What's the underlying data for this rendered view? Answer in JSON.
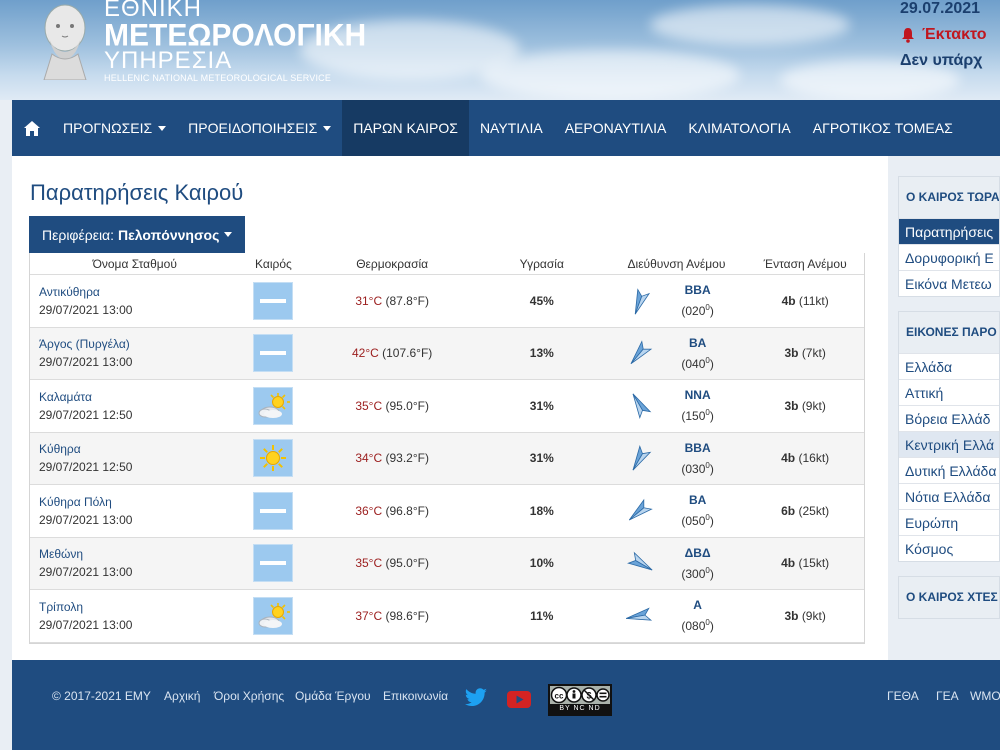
{
  "header": {
    "logo_line1": "ΕΘΝΙΚΗ",
    "logo_line2": "ΜΕΤΕΩΡΟΛΟΓΙΚΗ",
    "logo_line3": "ΥΠΗΡΕΣΙΑ",
    "logo_line4": "HELLENIC NATIONAL METEOROLOGICAL SERVICE",
    "date": "29.07.2021",
    "alert_label": "Έκτακτο",
    "no_alert_text": "Δεν υπάρχ"
  },
  "nav": {
    "home_icon": "home-icon",
    "items": [
      {
        "label": "ΠΡΟΓΝΩΣΕΙΣ",
        "dropdown": true
      },
      {
        "label": "ΠΡΟΕΙΔΟΠΟΙΗΣΕΙΣ",
        "dropdown": true
      },
      {
        "label": "ΠΑΡΩΝ ΚΑΙΡΟΣ",
        "active": true
      },
      {
        "label": "ΝΑΥΤΙΛΙΑ"
      },
      {
        "label": "ΑΕΡΟΝΑΥΤΙΛΙΑ"
      },
      {
        "label": "ΚΛΙΜΑΤΟΛΟΓΙΑ"
      },
      {
        "label": "ΑΓΡΟΤΙΚΟΣ ΤΟΜΕΑΣ"
      }
    ]
  },
  "main": {
    "title": "Παρατηρήσεις Καιρού",
    "region_label": "Περιφέρεια:",
    "region_value": "Πελοπόννησος",
    "columns": [
      "Όνομα Σταθμού",
      "Καιρός",
      "Θερμοκρασία",
      "Υγρασία",
      "Διεύθυνση Ανέμου",
      "Ένταση Ανέμου"
    ],
    "rows": [
      {
        "name": "Αντικύθηρα",
        "time": "29/07/2021 13:00",
        "weather": "haze",
        "temp_c": "31°C",
        "temp_f": "(87.8°F)",
        "humidity": "45%",
        "wind_dir": "ΒΒΑ",
        "wind_deg": "(020",
        "wind_deg_sup": "0",
        "wind_deg_close": ")",
        "wind_angle": 20,
        "wind_bf": "4b",
        "wind_kt": "(11kt)"
      },
      {
        "name": "Άργος (Πυργέλα)",
        "time": "29/07/2021 13:00",
        "weather": "haze",
        "temp_c": "42°C",
        "temp_f": "(107.6°F)",
        "humidity": "13%",
        "wind_dir": "ΒΑ",
        "wind_deg": "(040",
        "wind_deg_sup": "0",
        "wind_deg_close": ")",
        "wind_angle": 40,
        "wind_bf": "3b",
        "wind_kt": "(7kt)"
      },
      {
        "name": "Καλαμάτα",
        "time": "29/07/2021 12:50",
        "weather": "partly-cloudy",
        "temp_c": "35°C",
        "temp_f": "(95.0°F)",
        "humidity": "31%",
        "wind_dir": "ΝΝΑ",
        "wind_deg": "(150",
        "wind_deg_sup": "0",
        "wind_deg_close": ")",
        "wind_angle": 150,
        "wind_bf": "3b",
        "wind_kt": "(9kt)"
      },
      {
        "name": "Κύθηρα",
        "time": "29/07/2021 12:50",
        "weather": "sunny",
        "temp_c": "34°C",
        "temp_f": "(93.2°F)",
        "humidity": "31%",
        "wind_dir": "ΒΒΑ",
        "wind_deg": "(030",
        "wind_deg_sup": "0",
        "wind_deg_close": ")",
        "wind_angle": 30,
        "wind_bf": "4b",
        "wind_kt": "(16kt)"
      },
      {
        "name": "Κύθηρα Πόλη",
        "time": "29/07/2021 13:00",
        "weather": "haze",
        "temp_c": "36°C",
        "temp_f": "(96.8°F)",
        "humidity": "18%",
        "wind_dir": "ΒΑ",
        "wind_deg": "(050",
        "wind_deg_sup": "0",
        "wind_deg_close": ")",
        "wind_angle": 50,
        "wind_bf": "6b",
        "wind_kt": "(25kt)"
      },
      {
        "name": "Μεθώνη",
        "time": "29/07/2021 13:00",
        "weather": "haze",
        "temp_c": "35°C",
        "temp_f": "(95.0°F)",
        "humidity": "10%",
        "wind_dir": "ΔΒΔ",
        "wind_deg": "(300",
        "wind_deg_sup": "0",
        "wind_deg_close": ")",
        "wind_angle": 300,
        "wind_bf": "4b",
        "wind_kt": "(15kt)"
      },
      {
        "name": "Τρίπολη",
        "time": "29/07/2021 13:00",
        "weather": "partly-cloudy",
        "temp_c": "37°C",
        "temp_f": "(98.6°F)",
        "humidity": "11%",
        "wind_dir": "Α",
        "wind_deg": "(080",
        "wind_deg_sup": "0",
        "wind_deg_close": ")",
        "wind_angle": 80,
        "wind_bf": "3b",
        "wind_kt": "(9kt)"
      }
    ]
  },
  "sidebar": {
    "box1_title": "Ο ΚΑΙΡΟΣ ΤΩΡΑ",
    "box1_items": [
      "Παρατηρήσεις",
      "Δορυφορική Ε",
      "Εικόνα Μετεω"
    ],
    "box2_title": "ΕΙΚΟΝΕΣ ΠΑΡΟ",
    "box2_items": [
      "Ελλάδα",
      "Αττική",
      "Βόρεια Ελλάδ",
      "Κεντρική Ελλά",
      "Δυτική Ελλάδα",
      "Νότια Ελλάδα",
      "Ευρώπη",
      "Κόσμος"
    ],
    "box3_title": "Ο ΚΑΙΡΟΣ ΧΤΕΣ"
  },
  "footer": {
    "copyright": "© 2017-2021 ΕΜΥ",
    "links": [
      "Αρχική",
      "Όροι Χρήσης",
      "Ομάδα Έργου",
      "Επικοινωνία"
    ],
    "right_links": [
      "ΓΕΘΑ",
      "ΓΕΑ",
      "WMO"
    ],
    "license_label": "BY NC ND"
  },
  "colors": {
    "primary": "#1f4c80",
    "nav_active": "#163a63",
    "temp_red": "#9b1d1d",
    "alert_red": "#c0161e",
    "icon_sky": "#9cc9ef"
  }
}
